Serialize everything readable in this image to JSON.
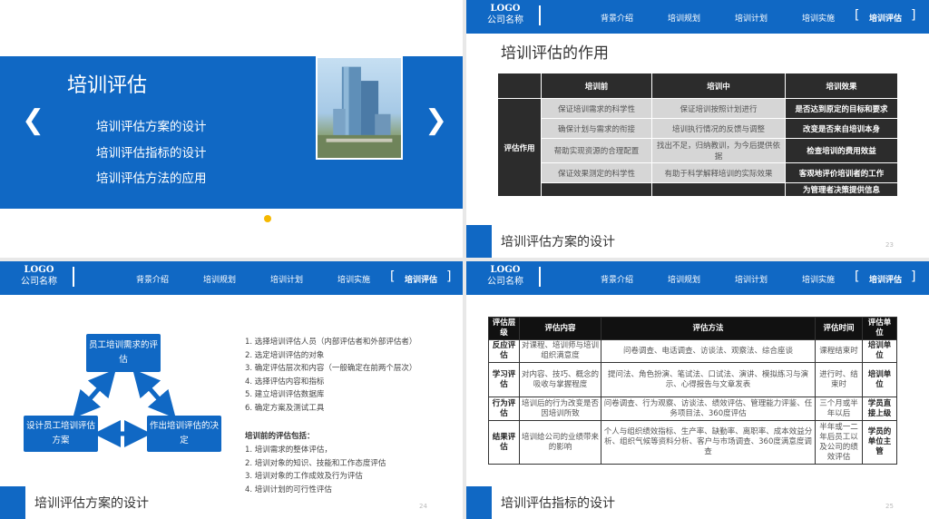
{
  "slide1": {
    "title": "培训评估",
    "items": [
      "培训评估方案的设计",
      "培训评估指标的设计",
      "培训评估方法的应用"
    ],
    "prev_icon": "chevron-left-icon",
    "next_icon": "chevron-right-icon"
  },
  "header": {
    "logo": "LOGO",
    "company": "公司名称",
    "nav": [
      "背景介绍",
      "培训规划",
      "培训计划",
      "培训实施",
      "培训评估"
    ],
    "active": "培训评估"
  },
  "slide2": {
    "title": "培训评估的作用",
    "footer": "培训评估方案的设计",
    "page": "23",
    "table": {
      "headers": [
        "培训前",
        "培训中",
        "培训效果"
      ],
      "side_label": "评估作用",
      "rows": [
        [
          "保证培训需求的科学性",
          "保证培训按照计划进行",
          "是否达到原定的目标和要求"
        ],
        [
          "确保计划与需求的衔接",
          "培训执行情况的反馈与调整",
          "改变是否来自培训本身"
        ],
        [
          "帮助实现资源的合理配置",
          "找出不足，归纳教训，为今后提供依据",
          "检查培训的费用效益"
        ],
        [
          "保证效果测定的科学性",
          "有助于科学解释培训的实际效果",
          "客观地评价培训者的工作"
        ],
        [
          "",
          "",
          "为管理者决策提供信息"
        ]
      ]
    }
  },
  "slide3": {
    "footer": "培训评估方案的设计",
    "page": "24",
    "boxes": {
      "top": "员工培训需求的评估",
      "left": "设计员工培训评估方案",
      "right": "作出培训评估的决定"
    },
    "steps": [
      "1.  选择培训评估人员（内部评估者和外部评估者）",
      "2.  选定培训评估的对象",
      "3.  确定评估层次和内容（一般确定在前两个层次）",
      "4.  选择评估内容和指标",
      "5.  建立培训评估数据库",
      "6.  确定方案及测试工具"
    ],
    "pre_title": "培训前的评估包括：",
    "pre_items": [
      "1.  培训需求的整体评估，",
      "2.  培训对象的知识、技能和工作态度评估",
      "3.  培训对象的工作成效及行为评估",
      "4.  培训计划的可行性评估"
    ]
  },
  "slide4": {
    "footer": "培训评估指标的设计",
    "page": "25",
    "table": {
      "headers": [
        "评估层级",
        "评估内容",
        "评估方法",
        "评估时间",
        "评估单位"
      ],
      "rows": [
        [
          "反应评估",
          "对课程、培训师与培训组织满意度",
          "问卷调查、电话调查、访谈法、观察法、综合座谈",
          "课程结束时",
          "培训单位"
        ],
        [
          "学习评估",
          "对内容、技巧、概念的吸收与掌握程度",
          "提问法、角色扮演、笔试法、口试法、演讲、模拟练习与演示、心得报告与文章发表",
          "进行时、结束时",
          "培训单位"
        ],
        [
          "行为评估",
          "培训后的行为改变是否因培训所致",
          "问卷调查、行为观察、访谈法、绩效评估、管理能力评鉴、任务项目法、360度评估",
          "三个月或半年以后",
          "学员直接上级"
        ],
        [
          "结果评估",
          "培训给公司的业绩带来的影响",
          "个人与组织绩效指标、生产率、缺勤率、离职率、成本效益分析、组织气候等资料分析、客户与市场调查、360度满意度调查",
          "半年或一二年后员工以及公司的绩效评估",
          "学员的单位主管"
        ]
      ]
    }
  }
}
